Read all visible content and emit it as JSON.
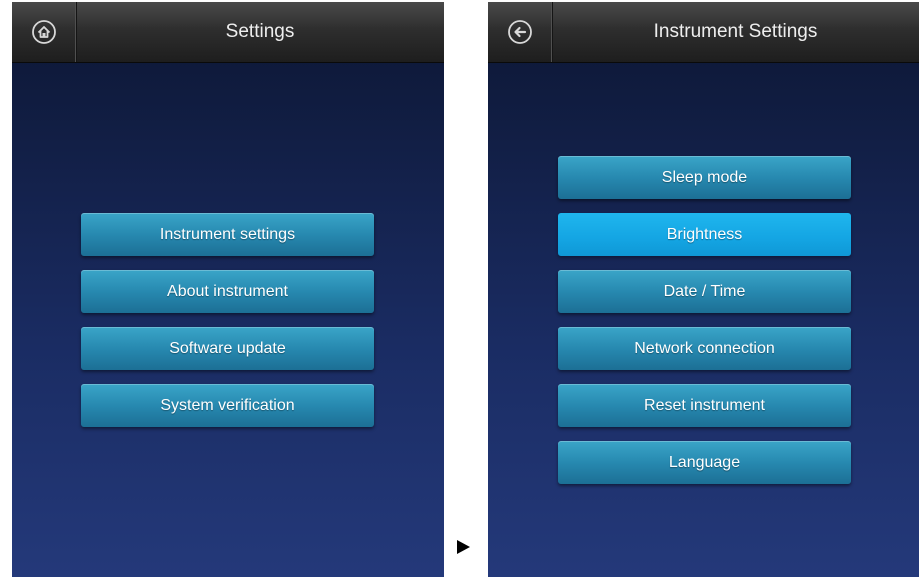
{
  "left_screen": {
    "title": "Settings",
    "nav_icon": "home-icon",
    "buttons": [
      {
        "label": "Instrument settings"
      },
      {
        "label": "About instrument"
      },
      {
        "label": "Software update"
      },
      {
        "label": "System verification"
      }
    ]
  },
  "right_screen": {
    "title": "Instrument Settings",
    "nav_icon": "back-arrow-icon",
    "selected_item": "Brightness",
    "buttons": [
      {
        "label": "Sleep mode"
      },
      {
        "label": "Brightness"
      },
      {
        "label": "Date / Time"
      },
      {
        "label": "Network connection"
      },
      {
        "label": "Reset instrument"
      },
      {
        "label": "Language"
      }
    ]
  },
  "transition_icon": "right-triangle-arrow-icon",
  "colors": {
    "button": "#2789b0",
    "button_selected": "#14a5e3",
    "background_top": "#0c1633",
    "background_bottom": "#24397a",
    "titlebar": "#2e2e2e"
  }
}
